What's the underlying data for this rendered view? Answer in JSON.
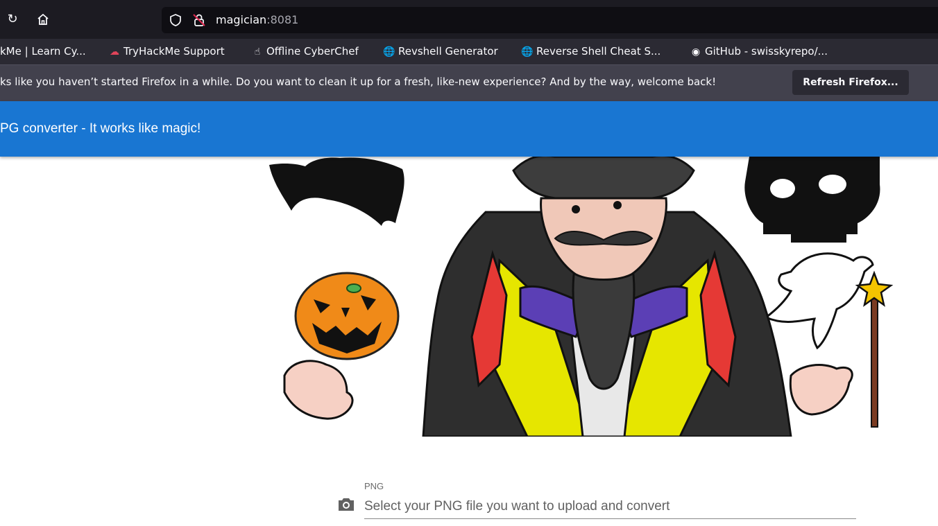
{
  "browser": {
    "url_host": "magician",
    "url_port": ":8081"
  },
  "bookmarks": [
    "kMe | Learn Cy...",
    "TryHackMe Support",
    "Offline CyberChef",
    "Revshell Generator",
    "Reverse Shell Cheat S...",
    "GitHub - swisskyrepo/..."
  ],
  "notification": {
    "text": "ks like you haven’t started Firefox in a while. Do you want to clean it up for a fresh, like-new experience? And by the way, welcome back!",
    "button": "Refresh Firefox..."
  },
  "app": {
    "title": "PG converter - It works like magic!"
  },
  "upload": {
    "label": "PNG",
    "placeholder": "Select your PNG file you want to upload and convert"
  },
  "icons": {
    "reload": "reload-icon",
    "home": "home-icon",
    "shield": "shield-icon",
    "lock": "insecure-lock-icon",
    "camera": "camera-icon"
  },
  "colors": {
    "header": "#1976d2",
    "nav": "#1c1b22",
    "bookmarks": "#2b2a33",
    "notice": "#42414d"
  }
}
